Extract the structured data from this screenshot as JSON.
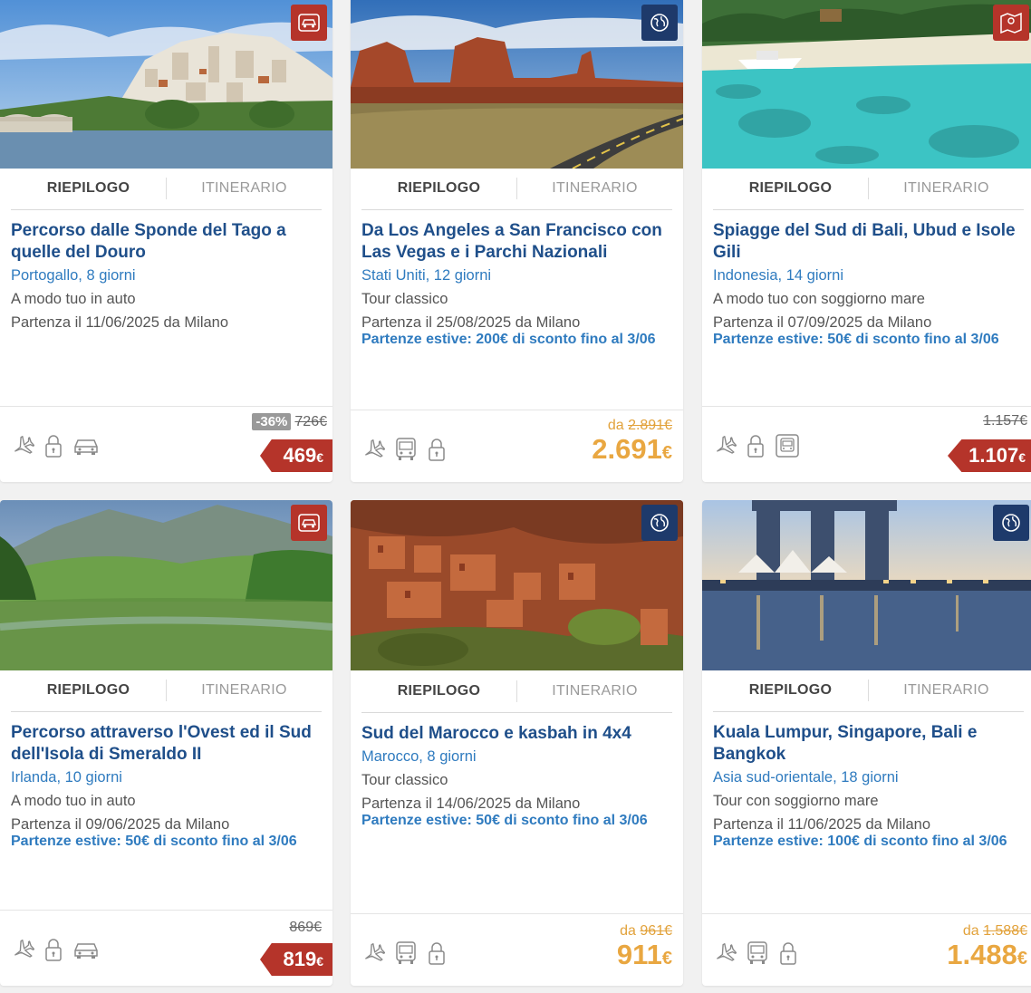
{
  "tabs": {
    "summary": "RIEPILOGO",
    "itinerary": "ITINERARIO"
  },
  "cards": [
    {
      "badge": "car-tour-icon",
      "badge_color": "#b5342a",
      "title": "Percorso dalle Sponde del Tago a quelle del Douro",
      "destination": "Portogallo, 8 giorni",
      "type": "A modo tuo in auto",
      "departure": "Partenza il 11/06/2025 da Milano",
      "promo": "",
      "features": [
        "plane-icon",
        "lock-icon",
        "car-icon"
      ],
      "discount": "-36%",
      "old_price": "726€",
      "price": "469",
      "currency": "€",
      "price_style": "ribbon"
    },
    {
      "badge": "globe-icon",
      "badge_color": "#1e3a6b",
      "title": "Da Los Angeles a San Francisco con Las Vegas e i Parchi Nazionali",
      "destination": "Stati Uniti, 12 giorni",
      "type": "Tour classico",
      "departure": "Partenza il 25/08/2025 da Milano",
      "promo": "Partenze estive: 200€ di sconto fino al 3/06",
      "features": [
        "plane-icon",
        "bus-icon",
        "lock-icon"
      ],
      "from": "da",
      "old_price": "2.891€",
      "price": "2.691",
      "currency": "€",
      "price_style": "orange"
    },
    {
      "badge": "map-pin-icon",
      "badge_color": "#b5342a",
      "title": "Spiagge del Sud di Bali, Ubud e Isole Gili",
      "destination": "Indonesia, 14 giorni",
      "type": "A modo tuo con soggiorno mare",
      "departure": "Partenza il 07/09/2025 da Milano",
      "promo": "Partenze estive: 50€ di sconto fino al 3/06",
      "features": [
        "plane-icon",
        "lock-icon",
        "transfer-icon"
      ],
      "old_price": "1.157€",
      "price": "1.107",
      "currency": "€",
      "price_style": "ribbon"
    },
    {
      "badge": "car-tour-icon",
      "badge_color": "#b5342a",
      "title": "Percorso attraverso l'Ovest ed il Sud dell'Isola di Smeraldo II",
      "destination": "Irlanda, 10 giorni",
      "type": "A modo tuo in auto",
      "departure": "Partenza il 09/06/2025 da Milano",
      "promo": "Partenze estive: 50€ di sconto fino al 3/06",
      "features": [
        "plane-icon",
        "lock-icon",
        "car-icon"
      ],
      "old_price": "869€",
      "price": "819",
      "currency": "€",
      "price_style": "ribbon"
    },
    {
      "badge": "globe-icon",
      "badge_color": "#1e3a6b",
      "title": "Sud del Marocco e kasbah in 4x4",
      "destination": "Marocco, 8 giorni",
      "type": "Tour classico",
      "departure": "Partenza il 14/06/2025 da Milano",
      "promo": "Partenze estive: 50€ di sconto fino al 3/06",
      "features": [
        "plane-icon",
        "bus-icon",
        "lock-icon"
      ],
      "from": "da",
      "old_price": "961€",
      "price": "911",
      "currency": "€",
      "price_style": "orange"
    },
    {
      "badge": "globe-icon",
      "badge_color": "#1e3a6b",
      "title": "Kuala Lumpur, Singapore, Bali e Bangkok",
      "destination": "Asia sud-orientale, 18 giorni",
      "type": "Tour con soggiorno mare",
      "departure": "Partenza il 11/06/2025 da Milano",
      "promo": "Partenze estive: 100€ di sconto fino al 3/06",
      "features": [
        "plane-icon",
        "bus-icon",
        "lock-icon"
      ],
      "from": "da",
      "old_price": "1.588€",
      "price": "1.488",
      "currency": "€",
      "price_style": "orange"
    }
  ]
}
